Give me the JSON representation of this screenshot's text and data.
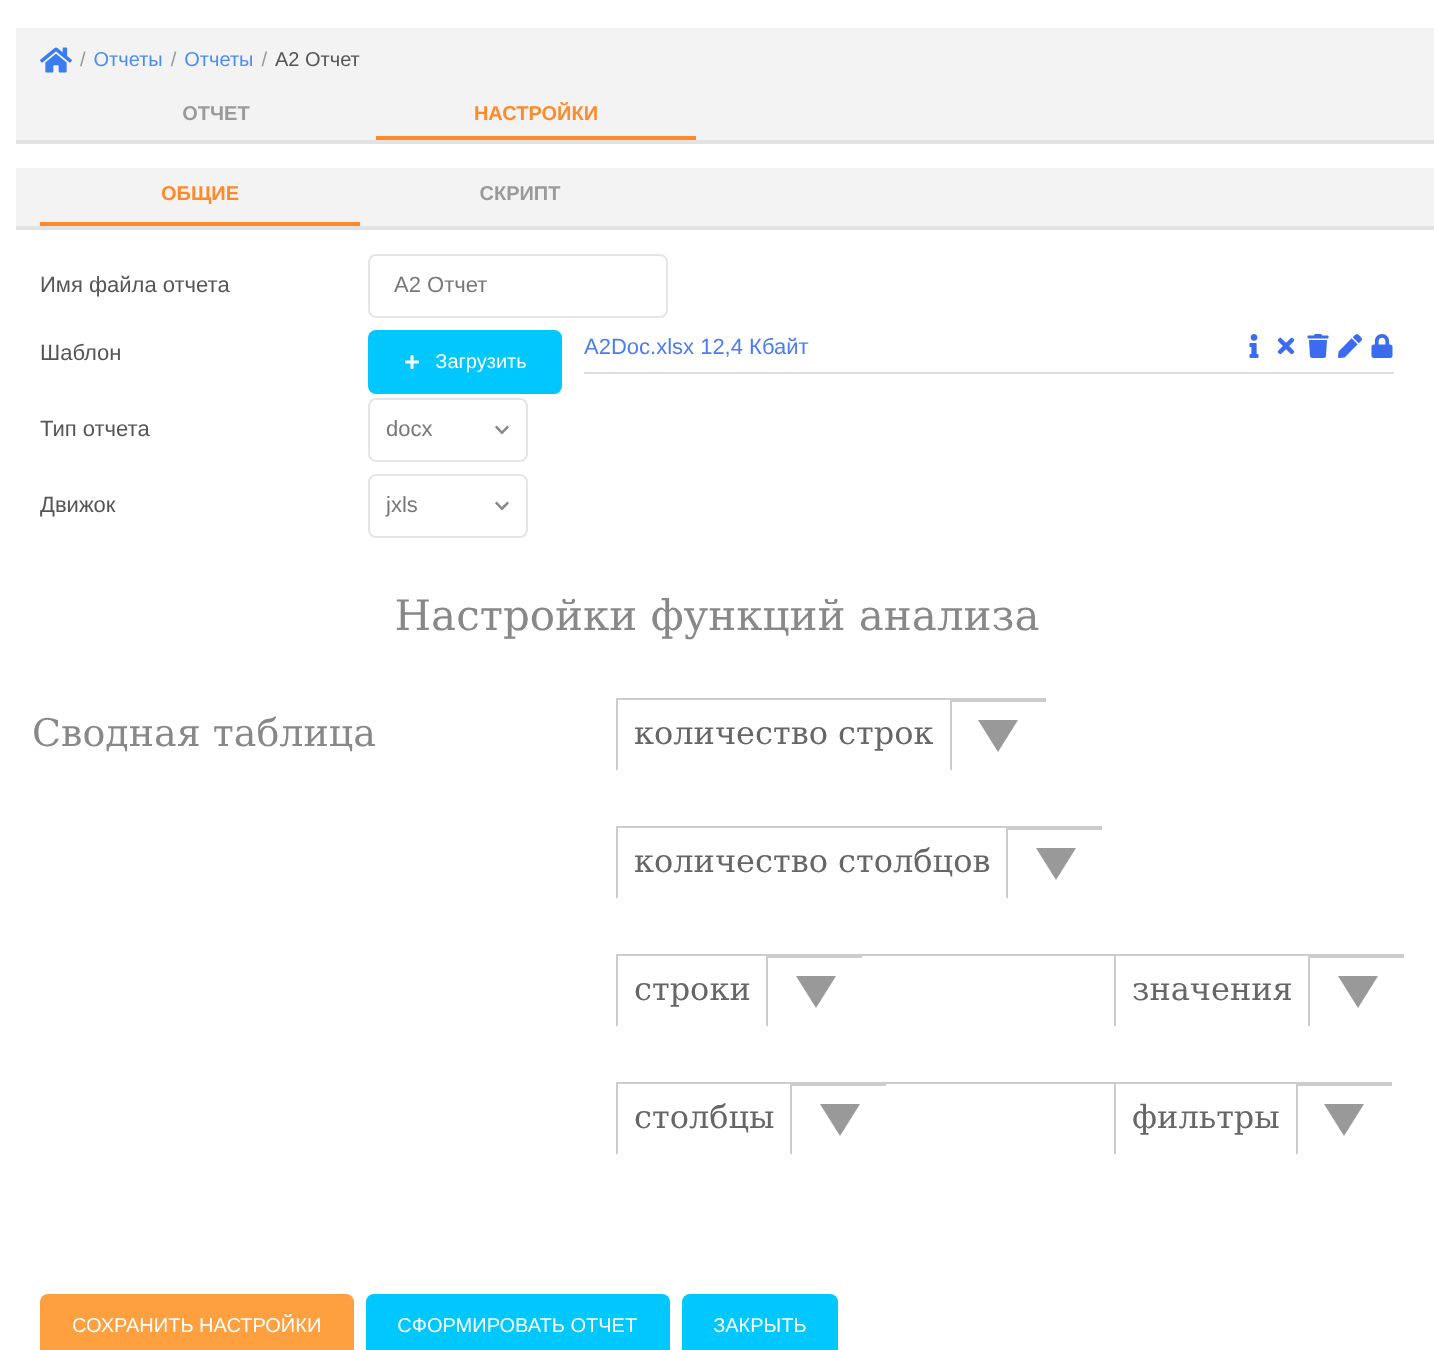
{
  "breadcrumbs": [
    {
      "separator": "/",
      "label": "Отчеты",
      "link": true
    },
    {
      "separator": "/",
      "label": "Отчеты",
      "link": true
    },
    {
      "separator": "/",
      "label": "A2 Отчет",
      "link": false
    }
  ],
  "main_tabs": [
    {
      "label": "ОТЧЕТ",
      "selected": false
    },
    {
      "label": "НАСТРОЙКИ",
      "selected": true
    }
  ],
  "sub_tabs": [
    {
      "label": "ОБЩИЕ",
      "selected": true
    },
    {
      "label": "СКРИПТ",
      "selected": false
    }
  ],
  "form": {
    "file_name": {
      "label": "Имя файла отчета",
      "value": "A2 Отчет"
    },
    "template": {
      "label": "Шаблон",
      "button": "Загрузить",
      "file": "A2Doc.xlsx 12,4 Кбайт"
    },
    "report_type": {
      "label": "Тип отчета",
      "value": "docx"
    },
    "engine": {
      "label": "Движок",
      "value": "jxls"
    }
  },
  "analysis": {
    "title": "Настройки функций анализа",
    "label": "Сводная таблица",
    "rows": [
      [
        {
          "value": "количество строк"
        }
      ],
      [
        {
          "value": "количество столбцов"
        }
      ],
      [
        {
          "value": "строки"
        },
        {
          "value": "значения"
        }
      ],
      [
        {
          "value": "столбцы"
        },
        {
          "value": "фильтры"
        }
      ]
    ]
  },
  "buttons": [
    {
      "label": "СОХРАНИТЬ НАСТРОЙКИ",
      "kind": "primary"
    },
    {
      "label": "СФОРМИРОВАТЬ ОТЧЕТ",
      "kind": "secondary"
    },
    {
      "label": "ЗАКРЫТЬ",
      "kind": "secondary"
    }
  ]
}
